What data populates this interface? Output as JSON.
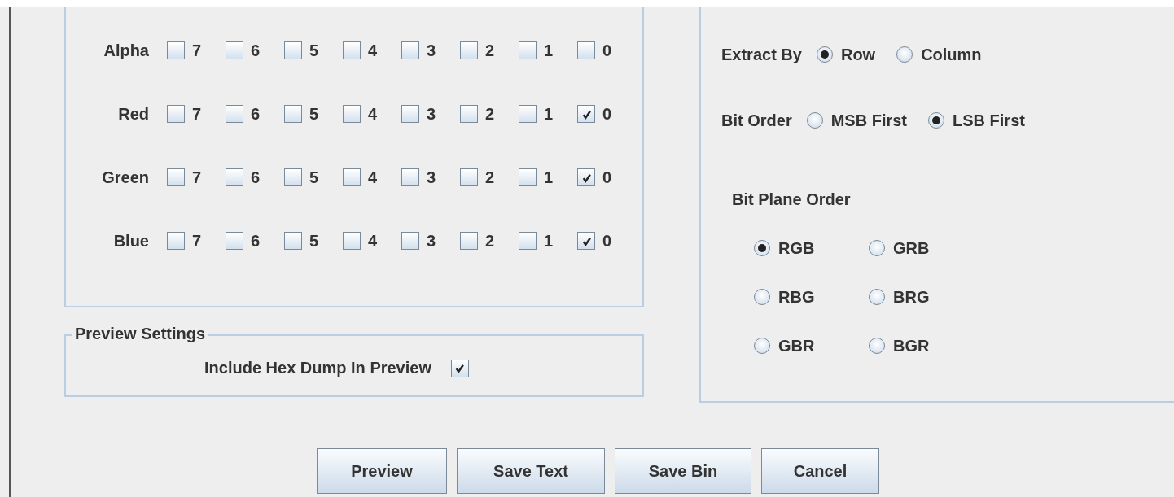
{
  "bit_planes": {
    "rows": [
      {
        "label": "Alpha",
        "bits": [
          {
            "label": "7",
            "checked": false
          },
          {
            "label": "6",
            "checked": false
          },
          {
            "label": "5",
            "checked": false
          },
          {
            "label": "4",
            "checked": false
          },
          {
            "label": "3",
            "checked": false
          },
          {
            "label": "2",
            "checked": false
          },
          {
            "label": "1",
            "checked": false
          },
          {
            "label": "0",
            "checked": false
          }
        ]
      },
      {
        "label": "Red",
        "bits": [
          {
            "label": "7",
            "checked": false
          },
          {
            "label": "6",
            "checked": false
          },
          {
            "label": "5",
            "checked": false
          },
          {
            "label": "4",
            "checked": false
          },
          {
            "label": "3",
            "checked": false
          },
          {
            "label": "2",
            "checked": false
          },
          {
            "label": "1",
            "checked": false
          },
          {
            "label": "0",
            "checked": true
          }
        ]
      },
      {
        "label": "Green",
        "bits": [
          {
            "label": "7",
            "checked": false
          },
          {
            "label": "6",
            "checked": false
          },
          {
            "label": "5",
            "checked": false
          },
          {
            "label": "4",
            "checked": false
          },
          {
            "label": "3",
            "checked": false
          },
          {
            "label": "2",
            "checked": false
          },
          {
            "label": "1",
            "checked": false
          },
          {
            "label": "0",
            "checked": true
          }
        ]
      },
      {
        "label": "Blue",
        "bits": [
          {
            "label": "7",
            "checked": false
          },
          {
            "label": "6",
            "checked": false
          },
          {
            "label": "5",
            "checked": false
          },
          {
            "label": "4",
            "checked": false
          },
          {
            "label": "3",
            "checked": false
          },
          {
            "label": "2",
            "checked": false
          },
          {
            "label": "1",
            "checked": false
          },
          {
            "label": "0",
            "checked": true
          }
        ]
      }
    ]
  },
  "preview_settings": {
    "title": "Preview Settings",
    "include_hex_dump": {
      "label": "Include Hex Dump In Preview",
      "checked": true
    }
  },
  "order_settings": {
    "extract_by": {
      "label": "Extract By",
      "options": [
        {
          "label": "Row",
          "selected": true
        },
        {
          "label": "Column",
          "selected": false
        }
      ]
    },
    "bit_order": {
      "label": "Bit Order",
      "options": [
        {
          "label": "MSB First",
          "selected": false
        },
        {
          "label": "LSB First",
          "selected": true
        }
      ]
    },
    "bit_plane_order": {
      "label": "Bit Plane Order",
      "options": [
        {
          "label": "RGB",
          "selected": true
        },
        {
          "label": "GRB",
          "selected": false
        },
        {
          "label": "RBG",
          "selected": false
        },
        {
          "label": "BRG",
          "selected": false
        },
        {
          "label": "GBR",
          "selected": false
        },
        {
          "label": "BGR",
          "selected": false
        }
      ]
    }
  },
  "buttons": [
    "Preview",
    "Save Text",
    "Save Bin",
    "Cancel"
  ]
}
